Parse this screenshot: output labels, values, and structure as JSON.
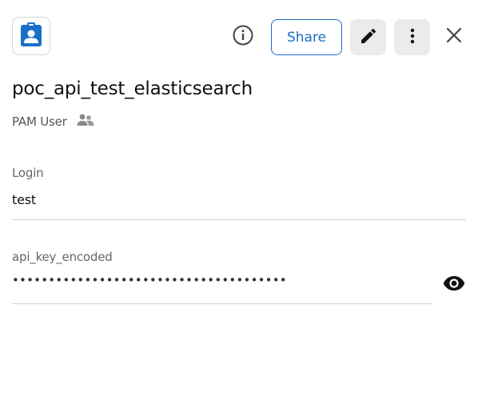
{
  "header": {
    "record_icon": "clipboard-user-icon",
    "info_icon": "info-icon",
    "share_label": "Share",
    "edit_icon": "pencil-icon",
    "more_icon": "vertical-dots-icon",
    "close_icon": "close-icon",
    "accent_color": "#1a6fc9"
  },
  "record": {
    "title": "poc_api_test_elasticsearch",
    "type": "PAM User",
    "type_icon": "users-icon"
  },
  "fields": {
    "login": {
      "label": "Login",
      "value": "test"
    },
    "api_key": {
      "label": "api_key_encoded",
      "masked_value": "••••••••••••••••••••••••••••••••••••••",
      "reveal_icon": "eye-icon"
    }
  }
}
